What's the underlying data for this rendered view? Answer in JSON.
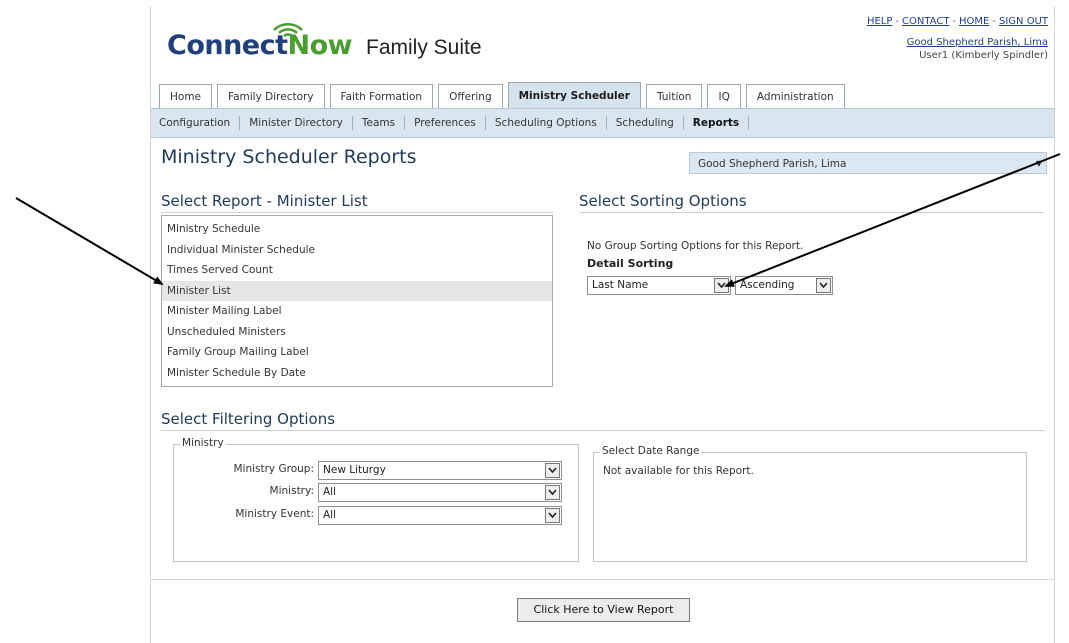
{
  "header": {
    "logo_text_a": "Connect",
    "logo_text_b": "Now",
    "suite_title": "Family Suite",
    "links": [
      "HELP",
      "CONTACT",
      "HOME",
      "SIGN OUT"
    ],
    "link_separator": "-",
    "parish_link": "Good Shepherd Parish, Lima",
    "user": "User1 (Kimberly Spindler)"
  },
  "tabs": [
    {
      "label": "Home",
      "active": false
    },
    {
      "label": "Family Directory",
      "active": false
    },
    {
      "label": "Faith Formation",
      "active": false
    },
    {
      "label": "Offering",
      "active": false
    },
    {
      "label": "Ministry Scheduler",
      "active": true
    },
    {
      "label": "Tuition",
      "active": false
    },
    {
      "label": "IQ",
      "active": false
    },
    {
      "label": "Administration",
      "active": false
    }
  ],
  "subnav": [
    {
      "label": "Configuration",
      "active": false
    },
    {
      "label": "Minister Directory",
      "active": false
    },
    {
      "label": "Teams",
      "active": false
    },
    {
      "label": "Preferences",
      "active": false
    },
    {
      "label": "Scheduling Options",
      "active": false
    },
    {
      "label": "Scheduling",
      "active": false
    },
    {
      "label": "Reports",
      "active": true
    }
  ],
  "main": {
    "page_title": "Ministry Scheduler Reports",
    "parish_select": "Good Shepherd Parish, Lima"
  },
  "reports": {
    "title": "Select Report - Minister List",
    "items": [
      "Ministry Schedule",
      "Individual Minister Schedule",
      "Times Served Count",
      "Minister List",
      "Minister Mailing Label",
      "Unscheduled Ministers",
      "Family Group Mailing Label",
      "Minister Schedule By Date"
    ],
    "selected_index": 3
  },
  "sorting": {
    "title": "Select Sorting Options",
    "group_note": "No Group Sorting Options for this Report.",
    "detail_label": "Detail Sorting",
    "field_value": "Last Name",
    "order_value": "Ascending"
  },
  "filtering": {
    "title": "Select Filtering Options",
    "ministry_legend": "Ministry",
    "ministry_group_label": "Ministry Group:",
    "ministry_group_value": "New Liturgy",
    "ministry_label": "Ministry:",
    "ministry_value": "All",
    "ministry_event_label": "Ministry Event:",
    "ministry_event_value": "All",
    "date_legend": "Select Date Range",
    "date_note": "Not available for this Report."
  },
  "actions": {
    "view_report": "Click Here to View Report"
  },
  "colors": {
    "brand_blue": "#1f3f7d",
    "brand_green": "#4a9d2f",
    "nav_bg": "#d9e6f0",
    "active_tab_bg": "#d5e3ee"
  }
}
